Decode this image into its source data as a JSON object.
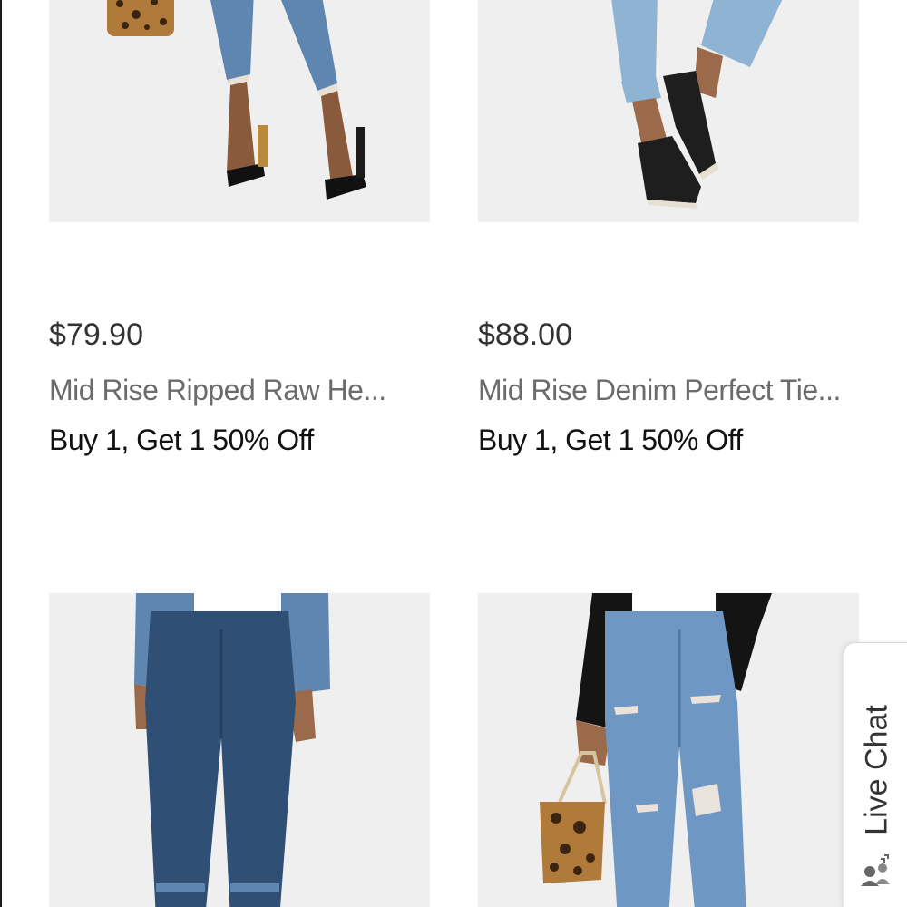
{
  "products": [
    {
      "price": "$79.90",
      "title": "Mid Rise Ripped Raw He...",
      "promo": "Buy 1, Get 1 50% Off",
      "image": "model-legs-ripped-jeans-black-heels"
    },
    {
      "price": "$88.00",
      "title": "Mid Rise Denim Perfect Tie...",
      "promo": "Buy 1, Get 1 50% Off",
      "image": "model-legs-light-jeans-black-slipons"
    },
    {
      "image": "model-dark-skinny-jeans-denim-jacket"
    },
    {
      "image": "model-ripped-jeans-leopard-bag"
    }
  ],
  "live_chat": {
    "label": "Live Chat",
    "icon": "chat-people-icon"
  },
  "colors": {
    "image_bg": "#efefef",
    "price_text": "#333333",
    "title_text": "#6b6b6b",
    "promo_text": "#111111",
    "denim_light": "#8fb3d3",
    "denim_mid": "#5f86b0",
    "denim_dark": "#2f4f74",
    "leopard": "#b07a3a"
  }
}
